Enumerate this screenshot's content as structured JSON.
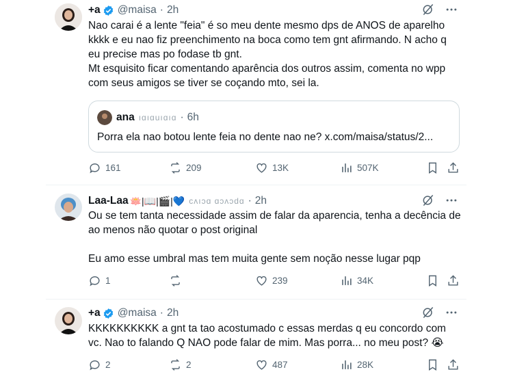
{
  "tweets": [
    {
      "name": "+a",
      "handle": "@maisa",
      "time": "2h",
      "text": "Nao carai é a lente \"feia\" é so meu dente mesmo dps de ANOS de aparelho kkkk e eu nao fiz preenchimento na boca como tem gnt afirmando. N acho q eu precise mas po fodase tb gnt.\nMt esquisito ficar comentando aparência dos outros assim, comenta no wpp com seus amigos se tiver se coçando mto, sei la.",
      "quote": {
        "name": "ana",
        "handle_obscured": "ıɑıɑuıɑıɑ",
        "time": "6h",
        "text": "Porra ela nao botou lente feia no dente nao ne? x.com/maisa/status/2..."
      },
      "stats": {
        "replies": "161",
        "retweets": "209",
        "likes": "13K",
        "views": "507K"
      }
    },
    {
      "name": "Laa-Laa",
      "handle_obscured": "cʌıɔɑ ɑɔʌɔdɑ",
      "time": "2h",
      "name_emojis": "🪷|📖|🎬|💙",
      "text": "Ou se tem tanta necessidade assim de falar da aparencia, tenha a decência de ao menos não quotar o post original\n\nEu amo esse umbral mas tem muita gente sem noção nesse lugar pqp",
      "stats": {
        "replies": "1",
        "retweets": "",
        "likes": "239",
        "views": "34K"
      }
    },
    {
      "name": "+a",
      "handle": "@maisa",
      "time": "2h",
      "text": "KKKKKKKKKK a gnt ta tao acostumado c essas merdas q eu concordo com vc. Nao to falando Q NAO pode falar de mim. Mas porra... no meu post? 😭",
      "stats": {
        "replies": "2",
        "retweets": "2",
        "likes": "487",
        "views": "28K"
      }
    }
  ],
  "colors": {
    "verified": "#1d9bf0",
    "muted": "#536471",
    "text": "#0f1419",
    "border": "#cfd9de"
  },
  "icons": [
    "verified-badge-icon",
    "grok-icon",
    "more-icon",
    "reply-icon",
    "retweet-icon",
    "like-icon",
    "views-icon",
    "bookmark-icon",
    "share-icon"
  ]
}
